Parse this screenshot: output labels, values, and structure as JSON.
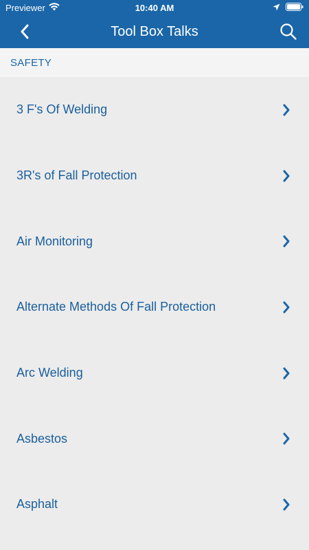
{
  "status_bar": {
    "carrier": "Previewer",
    "time": "10:40 AM",
    "icons": [
      "wifi-icon",
      "location-arrow-icon",
      "battery-icon"
    ]
  },
  "nav": {
    "title": "Tool Box Talks",
    "back_icon": "chevron-left-icon",
    "search_icon": "search-icon"
  },
  "section": {
    "title": "SAFETY"
  },
  "items": [
    {
      "label": "3 F's Of Welding"
    },
    {
      "label": "3R's of Fall Protection"
    },
    {
      "label": "Air Monitoring"
    },
    {
      "label": "Alternate Methods Of Fall Protection"
    },
    {
      "label": "Arc Welding"
    },
    {
      "label": "Asbestos"
    },
    {
      "label": "Asphalt"
    }
  ],
  "colors": {
    "primary": "#1a66a8",
    "link_text": "#1a5f9c",
    "background": "#ececec",
    "section_bg": "#f4f4f4"
  }
}
